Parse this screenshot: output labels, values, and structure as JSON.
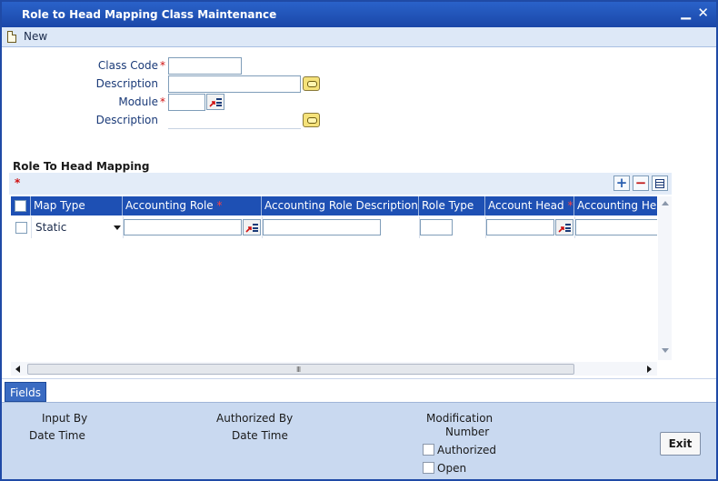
{
  "window": {
    "title": "Role to Head Mapping Class Maintenance",
    "minimize_glyph": "▁",
    "close_glyph": "✕"
  },
  "toolbar": {
    "new_label": "New"
  },
  "form": {
    "class_code_label": "Class Code",
    "class_code_value": "",
    "description1_label": "Description",
    "description1_value": "",
    "module_label": "Module",
    "module_value": "",
    "description2_label": "Description",
    "description2_value": "",
    "required_mark": "*"
  },
  "section": {
    "title": "Role To Head Mapping",
    "required_mark": "*"
  },
  "grid": {
    "add_glyph": "+",
    "delete_glyph": "−",
    "columns": [
      {
        "label": "Map Type",
        "required": false
      },
      {
        "label": "Accounting Role",
        "required": true
      },
      {
        "label": "Accounting Role Description",
        "required": false
      },
      {
        "label": "Role Type",
        "required": false
      },
      {
        "label": "Account Head",
        "required": true
      },
      {
        "label": "Accounting Head",
        "required": false
      }
    ],
    "rows": [
      {
        "map_type": "Static",
        "accounting_role": "",
        "role_description": "",
        "role_type": "",
        "account_head": "",
        "accounting_head": ""
      }
    ],
    "scroll_grip": "III"
  },
  "tabs": {
    "fields_label": "Fields"
  },
  "footer": {
    "input_by": "Input By",
    "date_time_1": "Date Time",
    "authorized_by": "Authorized By",
    "date_time_2": "Date Time",
    "modification": "Modification",
    "number": "Number",
    "authorized_label": "Authorized",
    "open_label": "Open",
    "exit_label": "Exit"
  },
  "colors": {
    "title_bar": "#1e50b4",
    "grid_header": "#1e50b4",
    "footer_bg": "#c9d9f0",
    "required": "#d01010"
  }
}
